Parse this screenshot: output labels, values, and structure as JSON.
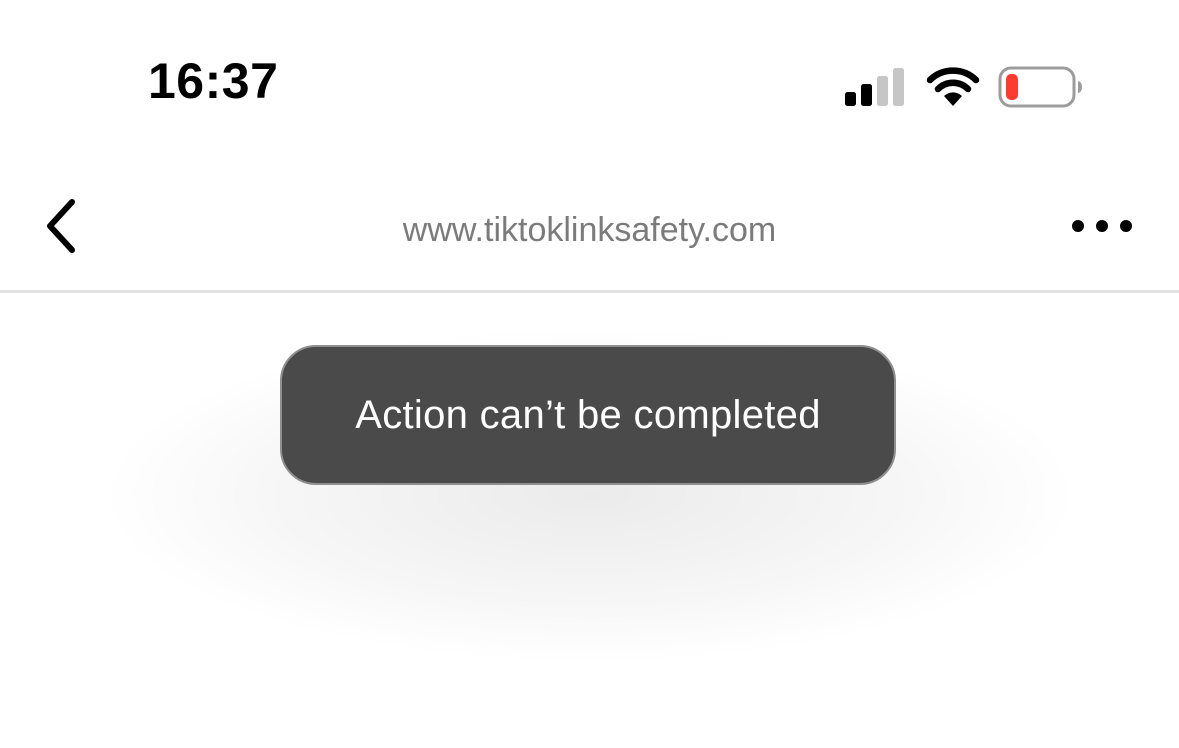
{
  "status_bar": {
    "time": "16:37",
    "signal_icon": "cellular-signal-icon",
    "signal_bars_active": 2,
    "signal_bars_total": 4,
    "wifi_icon": "wifi-icon",
    "battery_icon": "battery-low-icon",
    "battery_level": 0.12,
    "battery_color": "#ff3b30"
  },
  "nav_bar": {
    "back_icon": "chevron-left-icon",
    "url": "www.tiktoklinksafety.com",
    "more_icon": "ellipsis-icon"
  },
  "toast": {
    "message": "Action can’t be completed",
    "background": "#4a4a4a"
  }
}
